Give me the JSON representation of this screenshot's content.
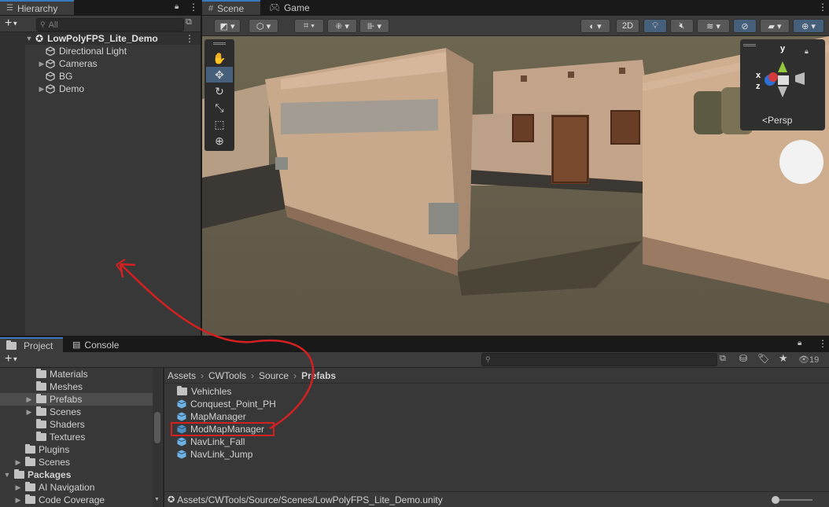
{
  "hierarchy": {
    "tab_label": "Hierarchy",
    "search_placeholder": "All",
    "scene_name": "LowPolyFPS_Lite_Demo",
    "items": [
      {
        "label": "Directional Light",
        "expandable": false
      },
      {
        "label": "Cameras",
        "expandable": true
      },
      {
        "label": "BG",
        "expandable": false
      },
      {
        "label": "Demo",
        "expandable": true
      }
    ]
  },
  "scene_view": {
    "tabs": [
      {
        "label": "Scene",
        "icon": "grid-icon",
        "active": true
      },
      {
        "label": "Game",
        "icon": "gamepad-icon",
        "active": false
      }
    ],
    "toggle_2d_label": "2D",
    "projection_label": "Persp",
    "gizmo_axes": {
      "x": "x",
      "y": "y",
      "z": "z"
    },
    "tools": [
      {
        "name": "hand-tool",
        "icon": "✋"
      },
      {
        "name": "move-tool",
        "icon": "✥"
      },
      {
        "name": "rotate-tool",
        "icon": "↻"
      },
      {
        "name": "scale-tool",
        "icon": "⤡"
      },
      {
        "name": "rect-tool",
        "icon": "⬚"
      },
      {
        "name": "transform-tool",
        "icon": "⊕"
      }
    ]
  },
  "bottom_panel": {
    "tabs": [
      {
        "label": "Project",
        "icon": "folder-icon",
        "active": true
      },
      {
        "label": "Console",
        "icon": "console-icon",
        "active": false
      }
    ],
    "hidden_count": "19",
    "tree": [
      {
        "label": "Materials",
        "indent": 2,
        "expandable": false,
        "selected": false
      },
      {
        "label": "Meshes",
        "indent": 2,
        "expandable": false,
        "selected": false
      },
      {
        "label": "Prefabs",
        "indent": 2,
        "expandable": true,
        "selected": true
      },
      {
        "label": "Scenes",
        "indent": 2,
        "expandable": true,
        "selected": false
      },
      {
        "label": "Shaders",
        "indent": 2,
        "expandable": false,
        "selected": false
      },
      {
        "label": "Textures",
        "indent": 2,
        "expandable": false,
        "selected": false
      },
      {
        "label": "Plugins",
        "indent": 1,
        "expandable": false,
        "selected": false
      },
      {
        "label": "Scenes",
        "indent": 1,
        "expandable": true,
        "selected": false
      },
      {
        "label": "Packages",
        "indent": 0,
        "expandable": true,
        "selected": false,
        "bold": true
      },
      {
        "label": "AI Navigation",
        "indent": 1,
        "expandable": true,
        "selected": false
      },
      {
        "label": "Code Coverage",
        "indent": 1,
        "expandable": true,
        "selected": false
      }
    ],
    "breadcrumb": [
      "Assets",
      "CWTools",
      "Source",
      "Prefabs"
    ],
    "files": [
      {
        "label": "Vehichles",
        "type": "folder"
      },
      {
        "label": "Conquest_Point_PH",
        "type": "prefab"
      },
      {
        "label": "MapManager",
        "type": "prefab"
      },
      {
        "label": "ModMapManager",
        "type": "prefab-variant",
        "highlighted": true
      },
      {
        "label": "NavLink_Fall",
        "type": "prefab"
      },
      {
        "label": "NavLink_Jump",
        "type": "prefab"
      }
    ],
    "status_path": "Assets/CWTools/Source/Scenes/LowPolyFPS_Lite_Demo.unity"
  },
  "colors": {
    "accent": "#3a79bb",
    "annotation": "#d42020",
    "prefab": "#6fb2e6"
  }
}
